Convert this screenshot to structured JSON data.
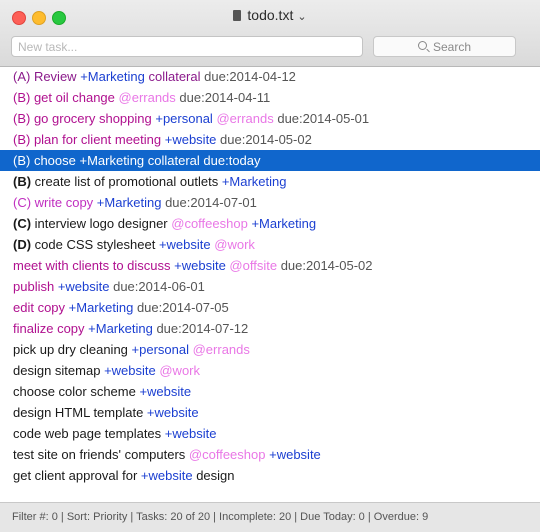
{
  "window": {
    "title": "todo.txt"
  },
  "toolbar": {
    "new_task_placeholder": "New task...",
    "search_label": "Search"
  },
  "colors": {
    "text": "#1a1a1a",
    "priority_a": "#8b1a8b",
    "priority_b": "#b0108f",
    "priority_c": "#c02fc0",
    "project": "#1b3fd1",
    "context": "#e977e6",
    "date": "#555555",
    "selection": "#1066cc"
  },
  "tasks": [
    {
      "selected": false,
      "segments": [
        {
          "text": "(A) Review ",
          "kind": "pri"
        },
        {
          "text": "+Marketing",
          "kind": "project"
        },
        {
          "text": " collateral ",
          "kind": "pri"
        },
        {
          "text": "due:2014-04-12",
          "kind": "date"
        }
      ],
      "priority": "A"
    },
    {
      "selected": false,
      "segments": [
        {
          "text": "(B) get oil change ",
          "kind": "pri"
        },
        {
          "text": "@errands",
          "kind": "context"
        },
        {
          "text": " due:2014-04-11",
          "kind": "date"
        }
      ],
      "priority": "B"
    },
    {
      "selected": false,
      "segments": [
        {
          "text": "(B) go grocery shopping ",
          "kind": "pri"
        },
        {
          "text": "+personal",
          "kind": "project"
        },
        {
          "text": " ",
          "kind": "pri"
        },
        {
          "text": "@errands",
          "kind": "context"
        },
        {
          "text": " due:2014-05-01",
          "kind": "date"
        }
      ],
      "priority": "B"
    },
    {
      "selected": false,
      "segments": [
        {
          "text": "(B) plan for client meeting ",
          "kind": "pri"
        },
        {
          "text": "+website",
          "kind": "project"
        },
        {
          "text": " due:2014-05-02",
          "kind": "date"
        }
      ],
      "priority": "B"
    },
    {
      "selected": true,
      "segments": [
        {
          "text": "(B) choose ",
          "kind": "pri"
        },
        {
          "text": "+Marketing",
          "kind": "project"
        },
        {
          "text": " collateral due:today",
          "kind": "pri"
        }
      ],
      "priority": "B"
    },
    {
      "selected": false,
      "segments": [
        {
          "text": "(B)",
          "kind": "bold"
        },
        {
          "text": " create list of promotional outlets ",
          "kind": "plain"
        },
        {
          "text": "+Marketing",
          "kind": "project"
        }
      ],
      "priority": "B"
    },
    {
      "selected": false,
      "segments": [
        {
          "text": "(C) write copy ",
          "kind": "pri"
        },
        {
          "text": "+Marketing",
          "kind": "project"
        },
        {
          "text": " due:2014-07-01",
          "kind": "date"
        }
      ],
      "priority": "C"
    },
    {
      "selected": false,
      "segments": [
        {
          "text": "(C)",
          "kind": "bold"
        },
        {
          "text": " interview logo designer ",
          "kind": "plain"
        },
        {
          "text": "@coffeeshop",
          "kind": "context"
        },
        {
          "text": " ",
          "kind": "plain"
        },
        {
          "text": "+Marketing",
          "kind": "project"
        }
      ],
      "priority": "C"
    },
    {
      "selected": false,
      "segments": [
        {
          "text": "(D)",
          "kind": "bold"
        },
        {
          "text": " code CSS stylesheet ",
          "kind": "plain"
        },
        {
          "text": "+website",
          "kind": "project"
        },
        {
          "text": " ",
          "kind": "plain"
        },
        {
          "text": "@work",
          "kind": "context"
        }
      ],
      "priority": "D"
    },
    {
      "selected": false,
      "segments": [
        {
          "text": "meet with clients to discuss ",
          "kind": "pri"
        },
        {
          "text": "+website",
          "kind": "project"
        },
        {
          "text": " ",
          "kind": "pri"
        },
        {
          "text": "@offsite",
          "kind": "context"
        },
        {
          "text": " due:2014-05-02",
          "kind": "date"
        }
      ],
      "priority": ""
    },
    {
      "selected": false,
      "segments": [
        {
          "text": "publish ",
          "kind": "pri"
        },
        {
          "text": "+website",
          "kind": "project"
        },
        {
          "text": " due:2014-06-01",
          "kind": "date"
        }
      ],
      "priority": ""
    },
    {
      "selected": false,
      "segments": [
        {
          "text": "edit copy ",
          "kind": "pri"
        },
        {
          "text": "+Marketing",
          "kind": "project"
        },
        {
          "text": " due:2014-07-05",
          "kind": "date"
        }
      ],
      "priority": ""
    },
    {
      "selected": false,
      "segments": [
        {
          "text": "finalize copy ",
          "kind": "pri"
        },
        {
          "text": "+Marketing",
          "kind": "project"
        },
        {
          "text": " due:2014-07-12",
          "kind": "date"
        }
      ],
      "priority": ""
    },
    {
      "selected": false,
      "segments": [
        {
          "text": "pick up dry cleaning ",
          "kind": "plain"
        },
        {
          "text": "+personal",
          "kind": "project"
        },
        {
          "text": " ",
          "kind": "plain"
        },
        {
          "text": "@errands",
          "kind": "context"
        }
      ],
      "priority": ""
    },
    {
      "selected": false,
      "segments": [
        {
          "text": "design sitemap ",
          "kind": "plain"
        },
        {
          "text": "+website",
          "kind": "project"
        },
        {
          "text": " ",
          "kind": "plain"
        },
        {
          "text": "@work",
          "kind": "context"
        }
      ],
      "priority": ""
    },
    {
      "selected": false,
      "segments": [
        {
          "text": "choose color scheme ",
          "kind": "plain"
        },
        {
          "text": "+website",
          "kind": "project"
        }
      ],
      "priority": ""
    },
    {
      "selected": false,
      "segments": [
        {
          "text": "design HTML template ",
          "kind": "plain"
        },
        {
          "text": "+website",
          "kind": "project"
        }
      ],
      "priority": ""
    },
    {
      "selected": false,
      "segments": [
        {
          "text": "code web page templates ",
          "kind": "plain"
        },
        {
          "text": "+website",
          "kind": "project"
        }
      ],
      "priority": ""
    },
    {
      "selected": false,
      "segments": [
        {
          "text": "test site on friends' computers ",
          "kind": "plain"
        },
        {
          "text": "@coffeeshop",
          "kind": "context"
        },
        {
          "text": " ",
          "kind": "plain"
        },
        {
          "text": "+website",
          "kind": "project"
        }
      ],
      "priority": ""
    },
    {
      "selected": false,
      "segments": [
        {
          "text": "get client approval for ",
          "kind": "plain"
        },
        {
          "text": "+website",
          "kind": "project"
        },
        {
          "text": " design",
          "kind": "plain"
        }
      ],
      "priority": ""
    }
  ],
  "status": {
    "text": "Filter #: 0 | Sort: Priority | Tasks: 20 of 20 | Incomplete: 20 | Due Today: 0 | Overdue: 9"
  }
}
